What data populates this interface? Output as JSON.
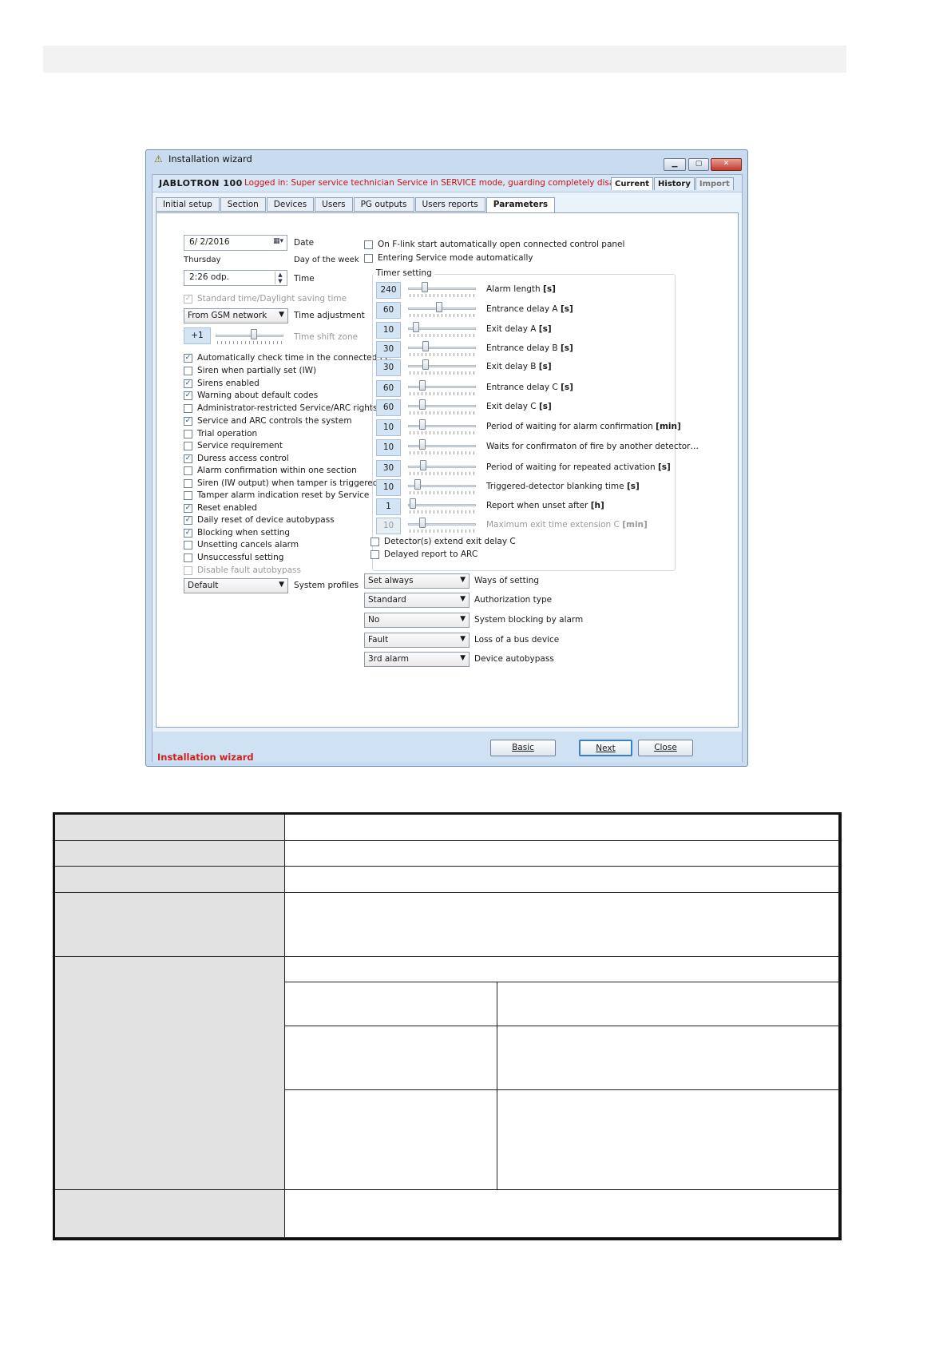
{
  "window": {
    "title": "Installation wizard",
    "brand": "JABLOTRON 100",
    "status": "Logged in: Super service technician Service in SERVICE mode, guarding completely disabled",
    "view_tabs": [
      "Current",
      "History",
      "Import"
    ],
    "tabs": [
      "Initial setup",
      "Section",
      "Devices",
      "Users",
      "PG outputs",
      "Users reports",
      "Parameters"
    ],
    "active_tab": "Parameters"
  },
  "left": {
    "date_value": "6/  2/2016",
    "date_label": "Date",
    "weekday_value": "Thursday",
    "weekday_label": "Day of the week",
    "time_value": "2:26 odp.",
    "time_label": "Time",
    "dst": "Standard time/Daylight saving time",
    "time_adjust_value": "From GSM network",
    "time_adjust_label": "Time adjustment",
    "shift_value": "+1",
    "shift_label": "Time shift zone",
    "checks": [
      {
        "label": "Automatically check time in the connected PC",
        "checked": true
      },
      {
        "label": "Siren when partially set (IW)",
        "checked": false
      },
      {
        "label": "Sirens enabled",
        "checked": true
      },
      {
        "label": "Warning about default codes",
        "checked": true
      },
      {
        "label": "Administrator-restricted Service/ARC rights",
        "checked": false
      },
      {
        "label": "Service and ARC controls the system",
        "checked": true
      },
      {
        "label": "Trial operation",
        "checked": false
      },
      {
        "label": "Service requirement",
        "checked": false
      },
      {
        "label": "Duress access control",
        "checked": true
      },
      {
        "label": "Alarm confirmation within one section",
        "checked": false
      },
      {
        "label": "Siren (IW output) when tamper is triggered",
        "checked": false
      },
      {
        "label": "Tamper alarm indication reset by Service",
        "checked": false
      },
      {
        "label": "Reset enabled",
        "checked": true
      },
      {
        "label": "Daily reset of device autobypass",
        "checked": true
      },
      {
        "label": "Blocking when setting",
        "checked": true
      },
      {
        "label": "Unsetting cancels alarm",
        "checked": false
      },
      {
        "label": "Unsuccessful setting",
        "checked": false
      },
      {
        "label": "Disable fault autobypass",
        "checked": false
      }
    ],
    "profile_value": "Default",
    "profile_label": "System profiles"
  },
  "right": {
    "top_checks": [
      {
        "label": "On F-link start automatically open connected control panel",
        "checked": false
      },
      {
        "label": "Entering Service mode automatically",
        "checked": false
      }
    ],
    "timer_title": "Timer setting",
    "timers": [
      {
        "value": "240",
        "label": "Alarm length",
        "unit": "[s]",
        "level": 0.22
      },
      {
        "value": "60",
        "label": "Entrance delay A",
        "unit": "[s]",
        "level": 0.46
      },
      {
        "value": "10",
        "label": "Exit delay A",
        "unit": "[s]",
        "level": 0.08
      },
      {
        "value": "30",
        "label": "Entrance delay B",
        "unit": "[s]",
        "level": 0.23
      },
      {
        "value": "30",
        "label": "Exit delay B",
        "unit": "[s]",
        "level": 0.23
      },
      {
        "value": "60",
        "label": "Entrance delay C",
        "unit": "[s]",
        "level": 0.18
      },
      {
        "value": "60",
        "label": "Exit delay C",
        "unit": "[s]",
        "level": 0.18
      },
      {
        "value": "10",
        "label": "Period of waiting for alarm confirmation",
        "unit": "[min]",
        "level": 0.18
      },
      {
        "value": "10",
        "label": "Waits for confirmaton of fire by another detector…",
        "unit": "",
        "level": 0.18
      },
      {
        "value": "30",
        "label": "Period of waiting for repeated activation",
        "unit": "[s]",
        "level": 0.2
      },
      {
        "value": "10",
        "label": "Triggered-detector blanking time",
        "unit": "[s]",
        "level": 0.1
      },
      {
        "value": "1",
        "label": "Report when unset after",
        "unit": "[h]",
        "level": 0.02
      },
      {
        "value": "10",
        "label": "Maximum exit time extension C",
        "unit": "[min]",
        "level": 0.18
      }
    ],
    "group_checks": [
      {
        "label": "Detector(s) extend exit delay C",
        "checked": false
      },
      {
        "label": "Delayed report to ARC",
        "checked": false
      }
    ],
    "selects": [
      {
        "value": "Set always",
        "label": "Ways of setting"
      },
      {
        "value": "Standard",
        "label": "Authorization type"
      },
      {
        "value": "No",
        "label": "System blocking by alarm"
      },
      {
        "value": "Fault",
        "label": "Loss of a bus device"
      },
      {
        "value": "3rd alarm",
        "label": "Device autobypass"
      }
    ]
  },
  "footer": {
    "wizard_label": "Installation wizard",
    "basic": "Basic",
    "next": "Next",
    "close": "Close"
  },
  "colors": {
    "accent_red": "#cc1111",
    "value_box": "#d3e5f4",
    "window_frame": "#c9dcef"
  }
}
